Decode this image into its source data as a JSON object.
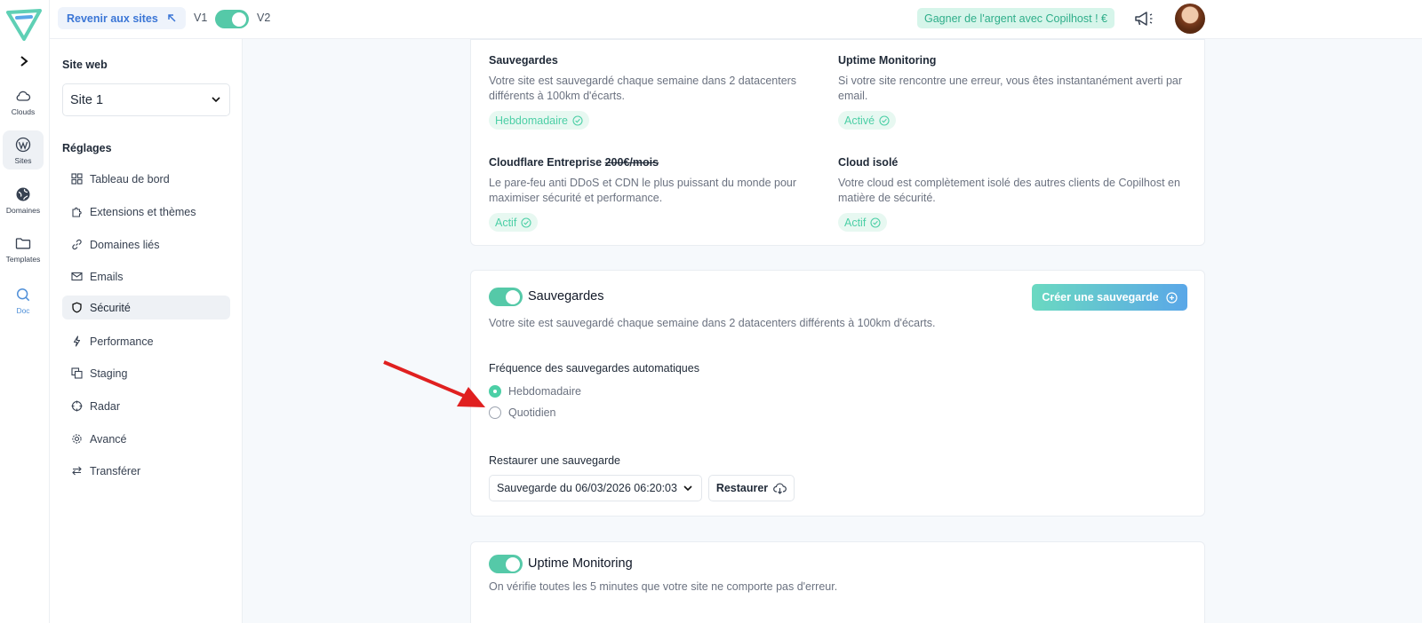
{
  "rail": {
    "items": [
      {
        "label": "Clouds",
        "icon": "cloud-icon"
      },
      {
        "label": "Sites",
        "icon": "wordpress-icon"
      },
      {
        "label": "Domaines",
        "icon": "globe-icon"
      },
      {
        "label": "Templates",
        "icon": "folder-icon"
      },
      {
        "label": "Doc",
        "icon": "search-icon"
      }
    ]
  },
  "topbar": {
    "back_label": "Revenir aux sites",
    "v1": "V1",
    "v2": "V2",
    "earn_label": "Gagner de l'argent avec Copilhost ! €"
  },
  "sidebar": {
    "site_heading": "Site web",
    "site_value": "Site 1",
    "settings_heading": "Réglages",
    "items": [
      {
        "label": "Tableau de bord",
        "icon": "dashboard-icon"
      },
      {
        "label": "Extensions et thèmes",
        "icon": "puzzle-icon"
      },
      {
        "label": "Domaines liés",
        "icon": "link-icon"
      },
      {
        "label": "Emails",
        "icon": "mail-icon"
      },
      {
        "label": "Sécurité",
        "icon": "shield-icon"
      },
      {
        "label": "Performance",
        "icon": "bolt-icon"
      },
      {
        "label": "Staging",
        "icon": "copy-icon"
      },
      {
        "label": "Radar",
        "icon": "crosshair-icon"
      },
      {
        "label": "Avancé",
        "icon": "gear-icon"
      },
      {
        "label": "Transférer",
        "icon": "transfer-icon"
      }
    ]
  },
  "features": {
    "backups": {
      "title": "Sauvegardes",
      "desc": "Votre site est sauvegardé chaque semaine dans 2 datacenters différents à 100km d'écarts.",
      "badge": "Hebdomadaire"
    },
    "uptime": {
      "title": "Uptime Monitoring",
      "desc": "Si votre site rencontre une erreur, vous êtes instantanément averti par email.",
      "badge": "Activé"
    },
    "cloudflare": {
      "title": "Cloudflare Entreprise",
      "price": "200€/mois",
      "desc": "Le pare-feu anti DDoS et CDN le plus puissant du monde pour maximiser sécurité et performance.",
      "badge": "Actif"
    },
    "isolated": {
      "title": "Cloud isolé",
      "desc": "Votre cloud est complètement isolé des autres clients de Copilhost en matière de sécurité.",
      "badge": "Actif"
    }
  },
  "backup_section": {
    "title": "Sauvegardes",
    "desc": "Votre site est sauvegardé chaque semaine dans 2 datacenters différents à 100km d'écarts.",
    "create_label": "Créer une sauvegarde",
    "frequency_label": "Fréquence des sauvegardes automatiques",
    "options": [
      "Hebdomadaire",
      "Quotidien"
    ],
    "selected": "Hebdomadaire",
    "restore_heading": "Restaurer une sauvegarde",
    "restore_select": "Sauvegarde du 06/03/2026 06:20:03",
    "restore_button": "Restaurer"
  },
  "uptime_section": {
    "title": "Uptime Monitoring",
    "desc": "On vérifie toutes les 5 minutes que votre site ne comporte pas d'erreur."
  },
  "colors": {
    "accent": "#55c9a8",
    "badge_text": "#4ccfa6",
    "link": "#3b76d6",
    "annotation_arrow": "#e02020"
  }
}
